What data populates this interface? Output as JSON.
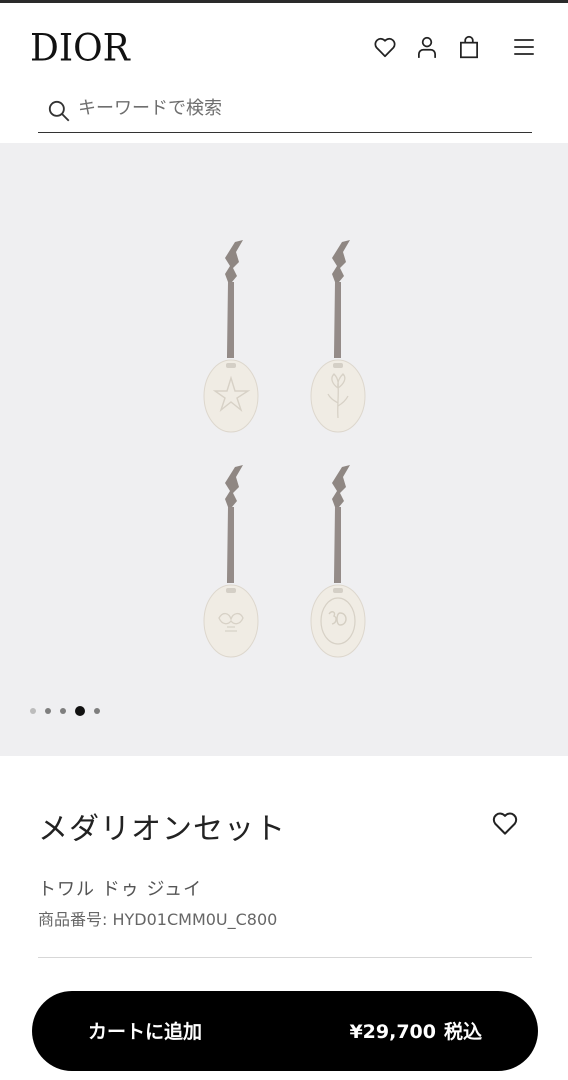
{
  "brand": {
    "logo_text": "DIOR"
  },
  "header": {
    "icons": [
      "heart-icon",
      "account-icon",
      "shopping-bag-icon",
      "menu-icon"
    ]
  },
  "search": {
    "placeholder": "キーワードで検索"
  },
  "gallery": {
    "slide_count": 5,
    "active_slide": 4,
    "ribbon_color": "#928a87",
    "medallion_color": "#f1ede5",
    "background": "#efeff1"
  },
  "product": {
    "title": "メダリオンセット",
    "collection": "トワル ドゥ ジュイ",
    "sku_label": "商品番号: HYD01CMM0U_C800"
  },
  "cart": {
    "button_label": "カートに追加",
    "price": "¥29,700",
    "tax_label": "税込"
  }
}
